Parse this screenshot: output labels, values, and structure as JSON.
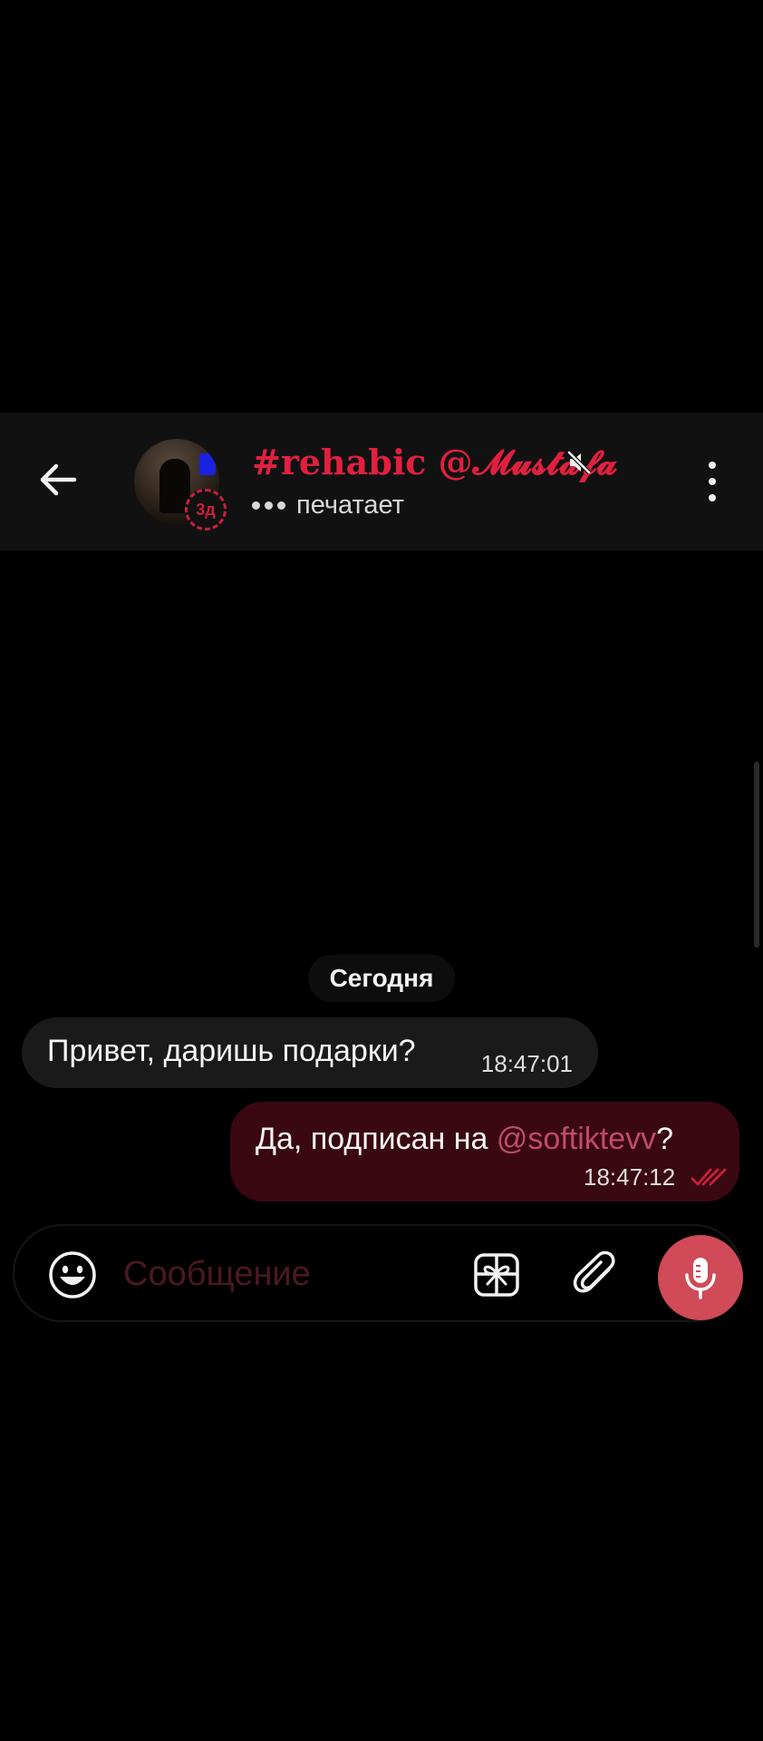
{
  "header": {
    "title": "#rehabic @𝓜𝓾𝓼𝓽𝓪𝓯𝓪",
    "status": "печатает",
    "story_badge": "3д",
    "icons": {
      "back": "arrow-left-icon",
      "muted": "muted-speaker-icon",
      "menu": "more-vertical-icon"
    },
    "accent_color": "#e0203e"
  },
  "date_separator": "Сегодня",
  "messages": [
    {
      "direction": "incoming",
      "text": "Привет, даришь подарки?",
      "time": "18:47:01"
    },
    {
      "direction": "outgoing",
      "text_before": "Да, подписан на ",
      "mention": "@softiktevv",
      "text_after": "?",
      "time": "18:47:12",
      "status": "read"
    }
  ],
  "composer": {
    "placeholder": "Сообщение",
    "value": "",
    "icons": {
      "emoji": "smiley-icon",
      "gift": "gift-icon",
      "attach": "paperclip-icon",
      "mic": "microphone-icon"
    },
    "mic_color": "#d04a58"
  }
}
